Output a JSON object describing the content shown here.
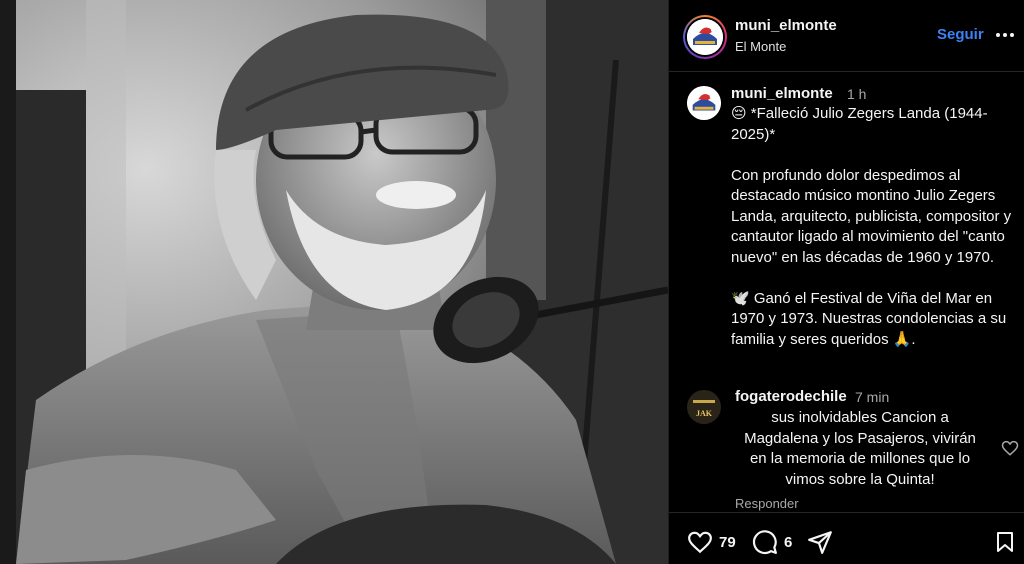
{
  "header": {
    "username": "muni_elmonte",
    "location": "El Monte",
    "follow_label": "Seguir"
  },
  "caption": {
    "username": "muni_elmonte",
    "time": "1 h",
    "title_line": "😔 *Falleció Julio Zegers Landa (1944-2025)*",
    "paragraph_1": "Con profundo dolor despedimos al destacado músico montino Julio Zegers Landa, arquitecto, publicista, compositor y cantautor ligado al movimiento del \"canto nuevo\" en las décadas de 1960 y 1970.",
    "paragraph_2": "🕊️ Ganó el Festival de Viña del Mar en 1970 y 1973. Nuestras condolencias a su familia y seres queridos 🙏."
  },
  "comment": {
    "username": "fogaterodechile",
    "time": "7 min",
    "text": "sus inolvidables Cancion a Magdalena y los Pasajeros, vivirán en la memoria de millones que lo vimos sobre la Quinta!",
    "reply_label": "Responder",
    "avatar_text": "JAK"
  },
  "actions": {
    "likes": "79",
    "comments": "6"
  },
  "icons": {
    "like": "heart-icon",
    "comment": "comment-bubble-icon",
    "share": "paper-plane-icon",
    "save": "bookmark-icon",
    "more": "more-horizontal-icon"
  },
  "colors": {
    "background": "#000000",
    "accent": "#3b82f6",
    "muted_text": "#a8a8a8"
  }
}
